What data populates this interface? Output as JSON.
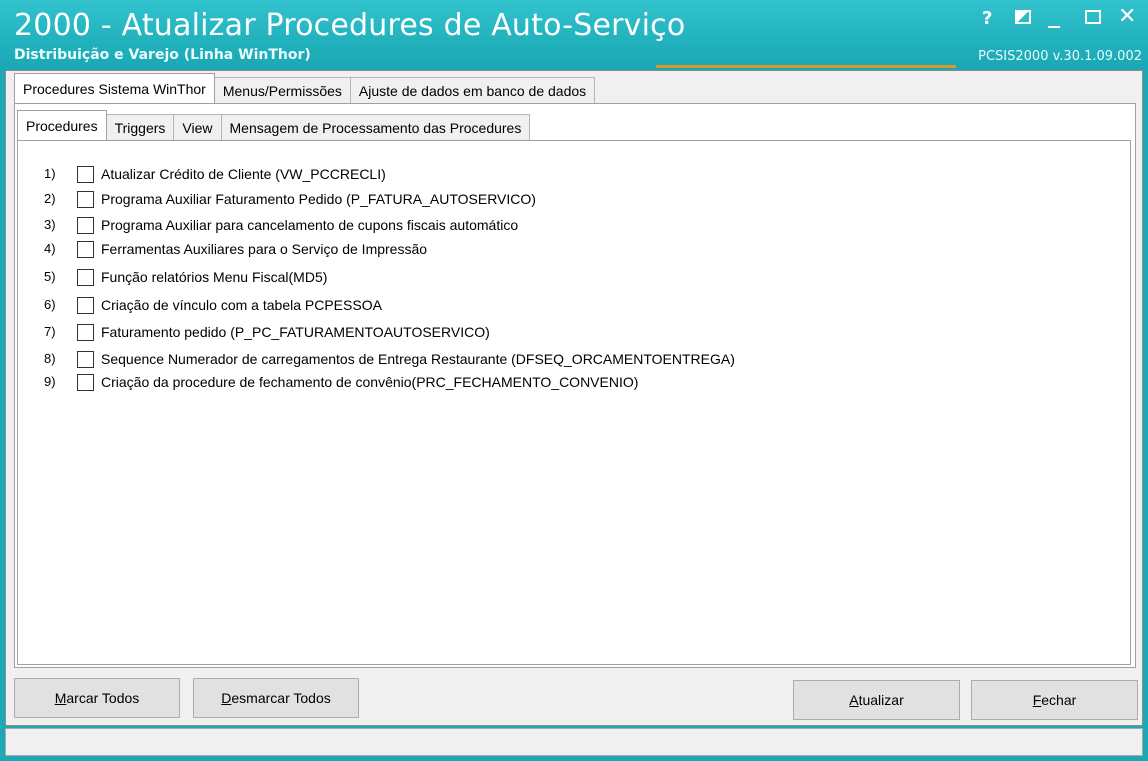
{
  "window": {
    "title": "2000 - Atualizar Procedures de Auto-Serviço",
    "subtitle": "Distribuição e Varejo (Linha WinThor)",
    "version": "PCSIS2000  v.30.1.09.002",
    "help_label": "?",
    "close_label": "✕"
  },
  "outer_tabs": [
    {
      "label": "Procedures Sistema WinThor",
      "active": true
    },
    {
      "label": "Menus/Permissões",
      "active": false
    },
    {
      "label": "Ajuste de dados em banco de dados",
      "active": false
    }
  ],
  "inner_tabs": [
    {
      "label": "Procedures",
      "active": true
    },
    {
      "label": "Triggers",
      "active": false
    },
    {
      "label": "View",
      "active": false
    },
    {
      "label": "Mensagem de Processamento das Procedures",
      "active": false
    }
  ],
  "procedures": [
    {
      "num": "1)",
      "label": "Atualizar Crédito de Cliente (VW_PCCRECLI)",
      "checked": false
    },
    {
      "num": "2)",
      "label": "Programa Auxiliar Faturamento Pedido  (P_FATURA_AUTOSERVICO)",
      "checked": false
    },
    {
      "num": "3)",
      "label": "Programa Auxiliar para cancelamento de cupons fiscais automático",
      "checked": false
    },
    {
      "num": "4)",
      "label": "Ferramentas Auxiliares para o Serviço de Impressão",
      "checked": false
    },
    {
      "num": "5)",
      "label": "Função relatórios Menu Fiscal(MD5)",
      "checked": false
    },
    {
      "num": "6)",
      "label": "Criação de vínculo com a tabela PCPESSOA",
      "checked": false
    },
    {
      "num": "7)",
      "label": "Faturamento pedido (P_PC_FATURAMENTOAUTOSERVICO)",
      "checked": false
    },
    {
      "num": "8)",
      "label": "Sequence Numerador de carregamentos de Entrega Restaurante (DFSEQ_ORCAMENTOENTREGA)",
      "checked": false
    },
    {
      "num": "9)",
      "label": "Criação da procedure de fechamento de convênio(PRC_FECHAMENTO_CONVENIO)",
      "checked": false
    }
  ],
  "buttons": {
    "mark_all_u": "M",
    "mark_all_rest": "arcar Todos",
    "unmark_all_u": "D",
    "unmark_all_rest": "esmarcar Todos",
    "update_u": "A",
    "update_rest": "tualizar",
    "close_u": "F",
    "close_rest": "echar"
  },
  "colors": {
    "titlebar": "#22b3bf",
    "accent_line": "#d99a2b",
    "panel": "#ffffff",
    "client": "#f0f0f0"
  }
}
